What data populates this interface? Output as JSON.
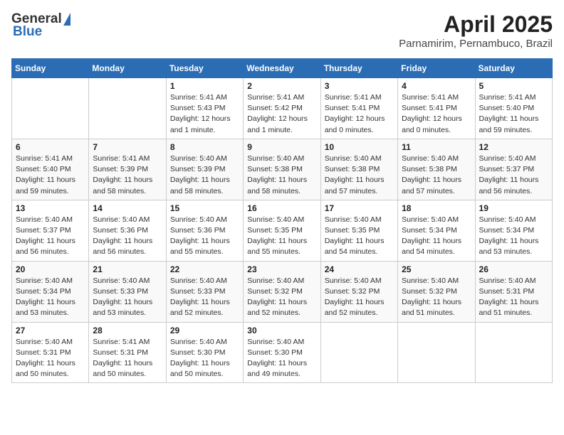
{
  "header": {
    "logo_general": "General",
    "logo_blue": "Blue",
    "month_year": "April 2025",
    "location": "Parnamirim, Pernambuco, Brazil"
  },
  "days_of_week": [
    "Sunday",
    "Monday",
    "Tuesday",
    "Wednesday",
    "Thursday",
    "Friday",
    "Saturday"
  ],
  "weeks": [
    [
      {
        "day": "",
        "detail": ""
      },
      {
        "day": "",
        "detail": ""
      },
      {
        "day": "1",
        "detail": "Sunrise: 5:41 AM\nSunset: 5:43 PM\nDaylight: 12 hours and 1 minute."
      },
      {
        "day": "2",
        "detail": "Sunrise: 5:41 AM\nSunset: 5:42 PM\nDaylight: 12 hours and 1 minute."
      },
      {
        "day": "3",
        "detail": "Sunrise: 5:41 AM\nSunset: 5:41 PM\nDaylight: 12 hours and 0 minutes."
      },
      {
        "day": "4",
        "detail": "Sunrise: 5:41 AM\nSunset: 5:41 PM\nDaylight: 12 hours and 0 minutes."
      },
      {
        "day": "5",
        "detail": "Sunrise: 5:41 AM\nSunset: 5:40 PM\nDaylight: 11 hours and 59 minutes."
      }
    ],
    [
      {
        "day": "6",
        "detail": "Sunrise: 5:41 AM\nSunset: 5:40 PM\nDaylight: 11 hours and 59 minutes."
      },
      {
        "day": "7",
        "detail": "Sunrise: 5:41 AM\nSunset: 5:39 PM\nDaylight: 11 hours and 58 minutes."
      },
      {
        "day": "8",
        "detail": "Sunrise: 5:40 AM\nSunset: 5:39 PM\nDaylight: 11 hours and 58 minutes."
      },
      {
        "day": "9",
        "detail": "Sunrise: 5:40 AM\nSunset: 5:38 PM\nDaylight: 11 hours and 58 minutes."
      },
      {
        "day": "10",
        "detail": "Sunrise: 5:40 AM\nSunset: 5:38 PM\nDaylight: 11 hours and 57 minutes."
      },
      {
        "day": "11",
        "detail": "Sunrise: 5:40 AM\nSunset: 5:38 PM\nDaylight: 11 hours and 57 minutes."
      },
      {
        "day": "12",
        "detail": "Sunrise: 5:40 AM\nSunset: 5:37 PM\nDaylight: 11 hours and 56 minutes."
      }
    ],
    [
      {
        "day": "13",
        "detail": "Sunrise: 5:40 AM\nSunset: 5:37 PM\nDaylight: 11 hours and 56 minutes."
      },
      {
        "day": "14",
        "detail": "Sunrise: 5:40 AM\nSunset: 5:36 PM\nDaylight: 11 hours and 56 minutes."
      },
      {
        "day": "15",
        "detail": "Sunrise: 5:40 AM\nSunset: 5:36 PM\nDaylight: 11 hours and 55 minutes."
      },
      {
        "day": "16",
        "detail": "Sunrise: 5:40 AM\nSunset: 5:35 PM\nDaylight: 11 hours and 55 minutes."
      },
      {
        "day": "17",
        "detail": "Sunrise: 5:40 AM\nSunset: 5:35 PM\nDaylight: 11 hours and 54 minutes."
      },
      {
        "day": "18",
        "detail": "Sunrise: 5:40 AM\nSunset: 5:34 PM\nDaylight: 11 hours and 54 minutes."
      },
      {
        "day": "19",
        "detail": "Sunrise: 5:40 AM\nSunset: 5:34 PM\nDaylight: 11 hours and 53 minutes."
      }
    ],
    [
      {
        "day": "20",
        "detail": "Sunrise: 5:40 AM\nSunset: 5:34 PM\nDaylight: 11 hours and 53 minutes."
      },
      {
        "day": "21",
        "detail": "Sunrise: 5:40 AM\nSunset: 5:33 PM\nDaylight: 11 hours and 53 minutes."
      },
      {
        "day": "22",
        "detail": "Sunrise: 5:40 AM\nSunset: 5:33 PM\nDaylight: 11 hours and 52 minutes."
      },
      {
        "day": "23",
        "detail": "Sunrise: 5:40 AM\nSunset: 5:32 PM\nDaylight: 11 hours and 52 minutes."
      },
      {
        "day": "24",
        "detail": "Sunrise: 5:40 AM\nSunset: 5:32 PM\nDaylight: 11 hours and 52 minutes."
      },
      {
        "day": "25",
        "detail": "Sunrise: 5:40 AM\nSunset: 5:32 PM\nDaylight: 11 hours and 51 minutes."
      },
      {
        "day": "26",
        "detail": "Sunrise: 5:40 AM\nSunset: 5:31 PM\nDaylight: 11 hours and 51 minutes."
      }
    ],
    [
      {
        "day": "27",
        "detail": "Sunrise: 5:40 AM\nSunset: 5:31 PM\nDaylight: 11 hours and 50 minutes."
      },
      {
        "day": "28",
        "detail": "Sunrise: 5:41 AM\nSunset: 5:31 PM\nDaylight: 11 hours and 50 minutes."
      },
      {
        "day": "29",
        "detail": "Sunrise: 5:40 AM\nSunset: 5:30 PM\nDaylight: 11 hours and 50 minutes."
      },
      {
        "day": "30",
        "detail": "Sunrise: 5:40 AM\nSunset: 5:30 PM\nDaylight: 11 hours and 49 minutes."
      },
      {
        "day": "",
        "detail": ""
      },
      {
        "day": "",
        "detail": ""
      },
      {
        "day": "",
        "detail": ""
      }
    ]
  ]
}
